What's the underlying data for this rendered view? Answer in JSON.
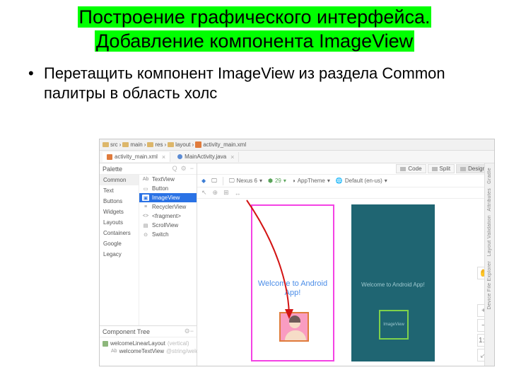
{
  "title_line1": "Построение графического интерфейса.",
  "title_line2": "Добавление компонента ImageView",
  "bullet_text": "Перетащить компонент ImageView из раздела Common палитры в область холс",
  "breadcrumbs": [
    "src",
    "main",
    "res",
    "layout",
    "activity_main.xml"
  ],
  "tabs": [
    {
      "label": "activity_main.xml",
      "active": true
    },
    {
      "label": "MainActivity.java",
      "active": false
    }
  ],
  "mode_buttons": {
    "code": "Code",
    "split": "Split",
    "design": "Design"
  },
  "palette": {
    "title": "Palette",
    "categories": [
      "Common",
      "Text",
      "Buttons",
      "Widgets",
      "Layouts",
      "Containers",
      "Google",
      "Legacy"
    ],
    "selected_category": "Common",
    "items": [
      {
        "label": "TextView",
        "icon": "Ab"
      },
      {
        "label": "Button",
        "icon": "▭"
      },
      {
        "label": "ImageView",
        "icon": "▣",
        "selected": true
      },
      {
        "label": "RecyclerView",
        "icon": "≡"
      },
      {
        "label": "<fragment>",
        "icon": "<>"
      },
      {
        "label": "ScrollView",
        "icon": "▤"
      },
      {
        "label": "Switch",
        "icon": "⊙"
      }
    ]
  },
  "tree": {
    "title": "Component Tree",
    "rows": [
      {
        "label": "welcomeLinearLayout",
        "hint": "(vertical)"
      },
      {
        "label": "welcomeTextView",
        "hint": "@string/welc…"
      }
    ]
  },
  "design_toolbar": {
    "device": "Nexus 6",
    "api": "29",
    "theme": "AppTheme",
    "locale": "Default (en-us)"
  },
  "preview": {
    "welcome_text": "Welcome to Android App!",
    "placeholder_label": "ImageView"
  },
  "right_tabs": [
    "Gradle",
    "Attributes",
    "Layout Validation",
    "Device File Explorer"
  ],
  "zoom": [
    "+",
    "−",
    "1:1",
    "⤢"
  ]
}
